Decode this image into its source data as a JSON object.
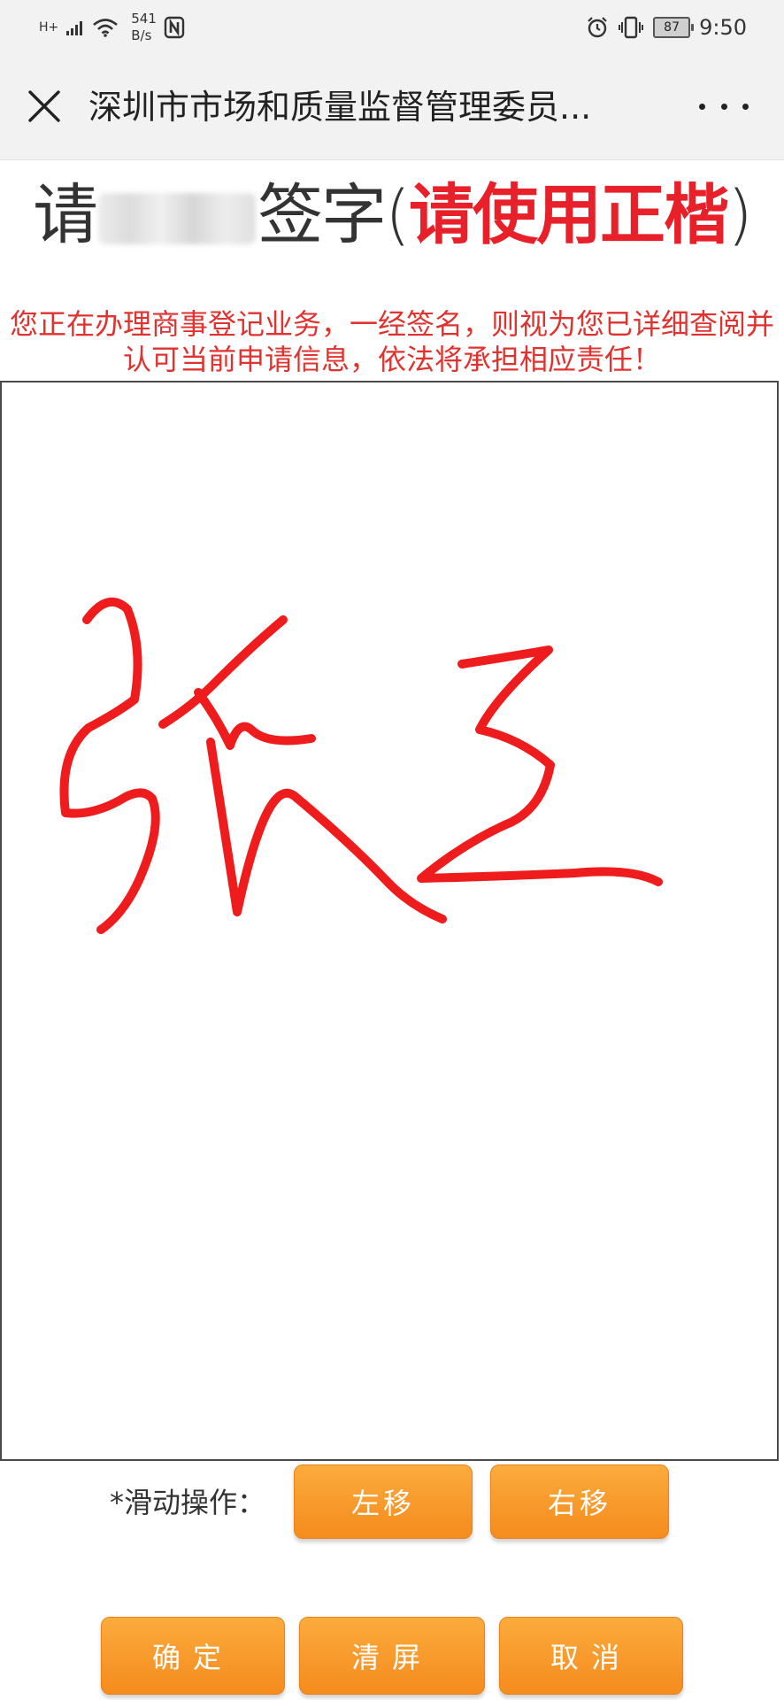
{
  "status_bar": {
    "network_type": "H+",
    "speed_value": "541",
    "speed_unit": "B/s",
    "nfc_icon": "nfc-icon",
    "alarm_icon": "alarm-icon",
    "vibrate_icon": "vibrate-icon",
    "battery_level": "87",
    "time": "9:50"
  },
  "titlebar": {
    "title": "深圳市市场和质量监督管理委员...",
    "close_icon": "close-icon",
    "more_icon": "more-dots-icon"
  },
  "header": {
    "prefix": "请",
    "suffix": "签字",
    "paren_open": "(",
    "emphasis": "请使用正楷",
    "paren_close": ")"
  },
  "notice": "您正在办理商事登记业务，一经签名，则视为您已详细查阅并认可当前申请信息，依法将承担相应责任！",
  "colors": {
    "accent_orange": "#f5901f",
    "signature_red": "#ee1c1c",
    "notice_red": "#e0322e",
    "emphasis_red": "#e8202a"
  },
  "slide": {
    "label": "*滑动操作：",
    "left_button": "左移",
    "right_button": "右移"
  },
  "actions": {
    "confirm": "确定",
    "clear": "清屏",
    "cancel": "取消"
  }
}
